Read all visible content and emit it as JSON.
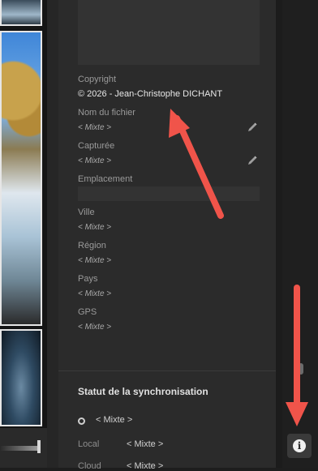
{
  "metadata": {
    "copyright": {
      "label": "Copyright",
      "value": "© 2026 - Jean-Christophe DICHANT"
    },
    "filename": {
      "label": "Nom du fichier",
      "value": "< Mixte >"
    },
    "captured": {
      "label": "Capturée",
      "value": "< Mixte >"
    },
    "location": {
      "label": "Emplacement"
    },
    "city": {
      "label": "Ville",
      "value": "< Mixte >"
    },
    "region": {
      "label": "Région",
      "value": "< Mixte >"
    },
    "country": {
      "label": "Pays",
      "value": "< Mixte >"
    },
    "gps": {
      "label": "GPS",
      "value": "< Mixte >"
    }
  },
  "sync": {
    "title": "Statut de la synchronisation",
    "status_value": "< Mixte >",
    "rows": [
      {
        "label": "Local",
        "value": "< Mixte >"
      },
      {
        "label": "Cloud",
        "value": "< Mixte >"
      }
    ]
  },
  "icons": {
    "edit": "pencil-icon",
    "info": "info-icon",
    "annotation": "red-arrow"
  },
  "colors": {
    "annotation_red": "#f0544a",
    "panel": "#2b2b2b",
    "background": "#1e1e1e"
  },
  "info_glyph": "i"
}
